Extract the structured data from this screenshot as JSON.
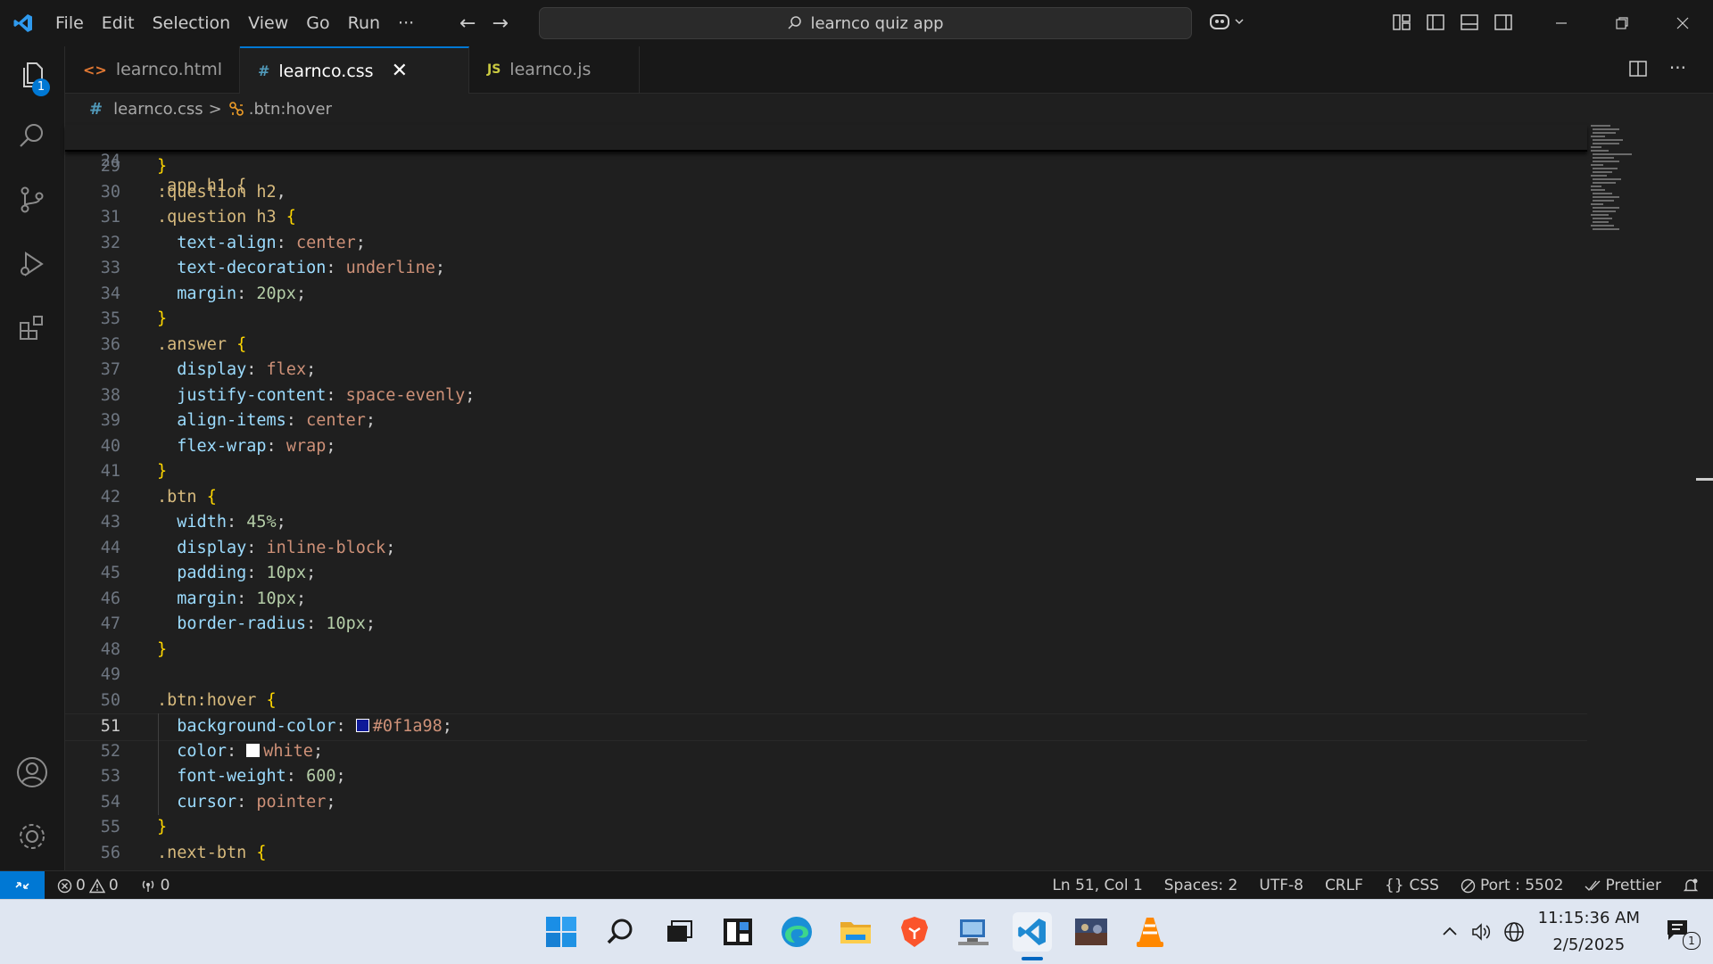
{
  "titlebar": {
    "menu": [
      "File",
      "Edit",
      "Selection",
      "View",
      "Go",
      "Run",
      "···"
    ],
    "search_text": "learnco quiz app"
  },
  "activity_bar": {
    "explorer_badge": "1"
  },
  "tabs": [
    {
      "label": "learnco.html",
      "icon": "<>",
      "icon_color": "#e37933"
    },
    {
      "label": "learnco.css",
      "icon": "#",
      "icon_color": "#519aba",
      "active": true
    },
    {
      "label": "learnco.js",
      "icon": "JS",
      "icon_color": "#cbcb41",
      "dirty": true
    }
  ],
  "breadcrumb": {
    "file_icon": "#",
    "file": "learnco.css",
    "separator": ">",
    "symbol": ".btn:hover"
  },
  "editor": {
    "sticky": {
      "number": "24",
      "text": ".app h1 {"
    },
    "lines": [
      {
        "n": "29",
        "tokens": [
          [
            "brace",
            "}"
          ]
        ]
      },
      {
        "n": "30",
        "tokens": [
          [
            "sel",
            ".question h2"
          ],
          [
            "punct",
            ","
          ]
        ]
      },
      {
        "n": "31",
        "tokens": [
          [
            "sel",
            ".question h3 "
          ],
          [
            "brace",
            "{"
          ]
        ]
      },
      {
        "n": "32",
        "tokens": [
          [
            "prop",
            "  text-align"
          ],
          [
            "punct",
            ": "
          ],
          [
            "val",
            "center"
          ],
          [
            "punct",
            ";"
          ]
        ]
      },
      {
        "n": "33",
        "tokens": [
          [
            "prop",
            "  text-decoration"
          ],
          [
            "punct",
            ": "
          ],
          [
            "val",
            "underline"
          ],
          [
            "punct",
            ";"
          ]
        ]
      },
      {
        "n": "34",
        "tokens": [
          [
            "prop",
            "  margin"
          ],
          [
            "punct",
            ": "
          ],
          [
            "num",
            "20px"
          ],
          [
            "punct",
            ";"
          ]
        ]
      },
      {
        "n": "35",
        "tokens": [
          [
            "brace",
            "}"
          ]
        ]
      },
      {
        "n": "36",
        "tokens": [
          [
            "sel",
            ".answer "
          ],
          [
            "brace",
            "{"
          ]
        ]
      },
      {
        "n": "37",
        "tokens": [
          [
            "prop",
            "  display"
          ],
          [
            "punct",
            ": "
          ],
          [
            "val",
            "flex"
          ],
          [
            "punct",
            ";"
          ]
        ]
      },
      {
        "n": "38",
        "tokens": [
          [
            "prop",
            "  justify-content"
          ],
          [
            "punct",
            ": "
          ],
          [
            "val",
            "space-evenly"
          ],
          [
            "punct",
            ";"
          ]
        ]
      },
      {
        "n": "39",
        "tokens": [
          [
            "prop",
            "  align-items"
          ],
          [
            "punct",
            ": "
          ],
          [
            "val",
            "center"
          ],
          [
            "punct",
            ";"
          ]
        ]
      },
      {
        "n": "40",
        "tokens": [
          [
            "prop",
            "  flex-wrap"
          ],
          [
            "punct",
            ": "
          ],
          [
            "val",
            "wrap"
          ],
          [
            "punct",
            ";"
          ]
        ]
      },
      {
        "n": "41",
        "tokens": [
          [
            "brace",
            "}"
          ]
        ]
      },
      {
        "n": "42",
        "tokens": [
          [
            "sel",
            ".btn "
          ],
          [
            "brace",
            "{"
          ]
        ]
      },
      {
        "n": "43",
        "tokens": [
          [
            "prop",
            "  width"
          ],
          [
            "punct",
            ": "
          ],
          [
            "num",
            "45%"
          ],
          [
            "punct",
            ";"
          ]
        ]
      },
      {
        "n": "44",
        "tokens": [
          [
            "prop",
            "  display"
          ],
          [
            "punct",
            ": "
          ],
          [
            "val",
            "inline-block"
          ],
          [
            "punct",
            ";"
          ]
        ]
      },
      {
        "n": "45",
        "tokens": [
          [
            "prop",
            "  padding"
          ],
          [
            "punct",
            ": "
          ],
          [
            "num",
            "10px"
          ],
          [
            "punct",
            ";"
          ]
        ]
      },
      {
        "n": "46",
        "tokens": [
          [
            "prop",
            "  margin"
          ],
          [
            "punct",
            ": "
          ],
          [
            "num",
            "10px"
          ],
          [
            "punct",
            ";"
          ]
        ]
      },
      {
        "n": "47",
        "tokens": [
          [
            "prop",
            "  border-radius"
          ],
          [
            "punct",
            ": "
          ],
          [
            "num",
            "10px"
          ],
          [
            "punct",
            ";"
          ]
        ]
      },
      {
        "n": "48",
        "tokens": [
          [
            "brace",
            "}"
          ]
        ]
      },
      {
        "n": "49",
        "tokens": []
      },
      {
        "n": "50",
        "tokens": [
          [
            "sel",
            ".btn:hover "
          ],
          [
            "brace",
            "{"
          ]
        ]
      },
      {
        "n": "51",
        "current": true,
        "tokens": [
          [
            "prop",
            "  background-color"
          ],
          [
            "punct",
            ": "
          ],
          [
            "swatch",
            "#0f1a98"
          ],
          [
            "val",
            "#0f1a98"
          ],
          [
            "punct",
            ";"
          ]
        ]
      },
      {
        "n": "52",
        "tokens": [
          [
            "prop",
            "  color"
          ],
          [
            "punct",
            ": "
          ],
          [
            "swatch",
            "#ffffff"
          ],
          [
            "val",
            "white"
          ],
          [
            "punct",
            ";"
          ]
        ]
      },
      {
        "n": "53",
        "tokens": [
          [
            "prop",
            "  font-weight"
          ],
          [
            "punct",
            ": "
          ],
          [
            "num",
            "600"
          ],
          [
            "punct",
            ";"
          ]
        ]
      },
      {
        "n": "54",
        "tokens": [
          [
            "prop",
            "  cursor"
          ],
          [
            "punct",
            ": "
          ],
          [
            "val",
            "pointer"
          ],
          [
            "punct",
            ";"
          ]
        ]
      },
      {
        "n": "55",
        "tokens": [
          [
            "brace",
            "}"
          ]
        ]
      },
      {
        "n": "56",
        "tokens": [
          [
            "sel",
            ".next-btn "
          ],
          [
            "brace",
            "{"
          ]
        ]
      }
    ]
  },
  "statusbar": {
    "errors": "0",
    "warnings": "0",
    "ports": "0",
    "position": "Ln 51, Col 1",
    "spaces": "Spaces: 2",
    "encoding": "UTF-8",
    "eol": "CRLF",
    "language": "CSS",
    "port": "Port : 5502",
    "prettier": "Prettier"
  },
  "taskbar": {
    "time": "11:15:36 AM",
    "date": "2/5/2025",
    "notification_count": "1"
  },
  "colors": {
    "accent": "#0078d4",
    "editor_bg": "#1f1f1f",
    "chrome_bg": "#181818"
  }
}
